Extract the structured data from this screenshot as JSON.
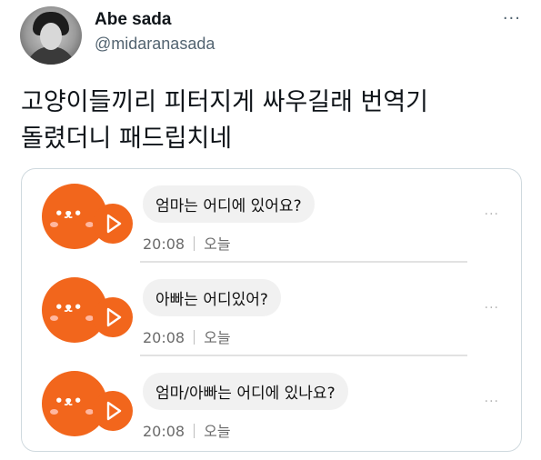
{
  "user": {
    "display_name": "Abe sada",
    "handle": "@midaranasada"
  },
  "more_label": "···",
  "tweet": {
    "line1": "고양이들끼리 피터지게 싸우길래 번역기",
    "line2": "돌렸더니 패드립치네"
  },
  "messages": [
    {
      "text": "엄마는 어디에 있어요?",
      "time": "20:08",
      "day": "오늘",
      "more": "···"
    },
    {
      "text": "아빠는 어디있어?",
      "time": "20:08",
      "day": "오늘",
      "more": "···"
    },
    {
      "text": "엄마/아빠는 어디에 있나요?",
      "time": "20:08",
      "day": "오늘",
      "more": "···"
    }
  ],
  "colors": {
    "accent_orange": "#f2661c",
    "bubble_bg": "#f1f1f1",
    "handle_gray": "#536471"
  },
  "icons": [
    "user-avatar",
    "more-icon",
    "cat-blob-icon",
    "play-icon"
  ]
}
